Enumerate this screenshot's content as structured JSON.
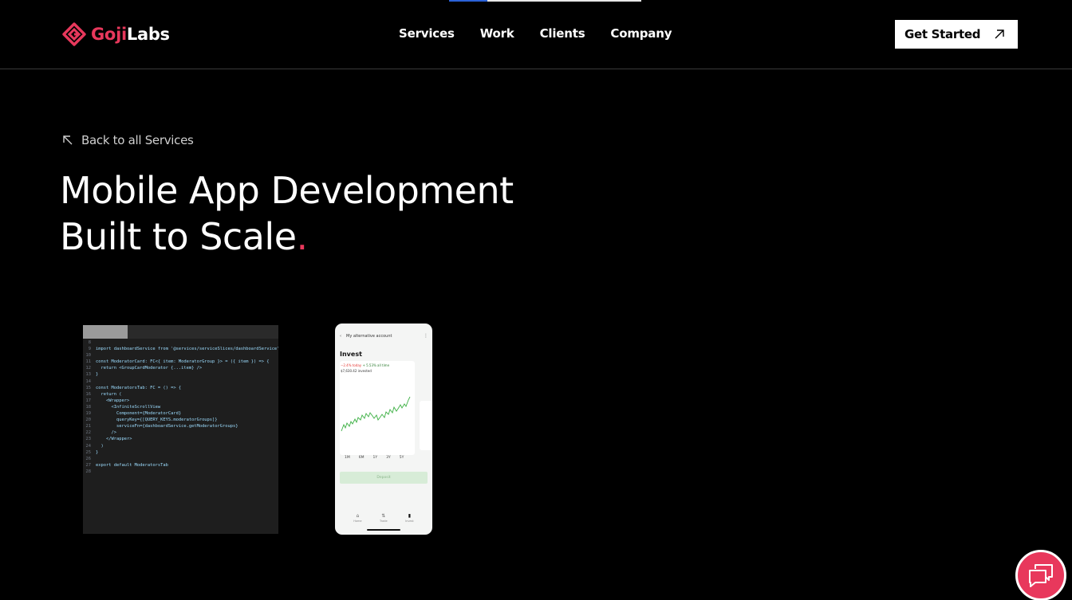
{
  "brand": {
    "name_part1": "Goji",
    "name_part2": "Labs",
    "accent_color": "#e8385c",
    "logo_icon": "diamond-logo-icon"
  },
  "nav": {
    "items": [
      {
        "label": "Services"
      },
      {
        "label": "Work"
      },
      {
        "label": "Clients"
      },
      {
        "label": "Company"
      }
    ],
    "cta_label": "Get Started",
    "cta_icon": "arrow-up-right-icon"
  },
  "hero": {
    "back_label": "Back to all Services",
    "back_icon": "arrow-up-left-icon",
    "title_line1": "Mobile App Development",
    "title_line2": "Built to Scale",
    "title_dot": "."
  },
  "code_preview": {
    "lines": [
      {
        "n": "8",
        "t": ""
      },
      {
        "n": "9",
        "t": "import dashboardService from '@services/serviceSlices/dashboardService'"
      },
      {
        "n": "10",
        "t": ""
      },
      {
        "n": "11",
        "t": "const ModeratorCard: FC<{ item: ModeratorGroup }> = ({ item }) => {"
      },
      {
        "n": "12",
        "t": "  return <GroupCardModerator {...item} />"
      },
      {
        "n": "13",
        "t": "}"
      },
      {
        "n": "14",
        "t": ""
      },
      {
        "n": "15",
        "t": "const ModeratorsTab: FC = () => {"
      },
      {
        "n": "16",
        "t": "  return ("
      },
      {
        "n": "17",
        "t": "    <Wrapper>"
      },
      {
        "n": "18",
        "t": "      <InfiniteScrollView"
      },
      {
        "n": "19",
        "t": "        Component={ModeratorCard}"
      },
      {
        "n": "20",
        "t": "        queryKey={[QUERY_KEYS.moderatorGroups]}"
      },
      {
        "n": "21",
        "t": "        serviceFn={dashboardService.getModeratorGroups}"
      },
      {
        "n": "22",
        "t": "      />"
      },
      {
        "n": "23",
        "t": "    </Wrapper>"
      },
      {
        "n": "24",
        "t": "  )"
      },
      {
        "n": "25",
        "t": "}"
      },
      {
        "n": "26",
        "t": ""
      },
      {
        "n": "27",
        "t": "export default ModeratorsTab"
      },
      {
        "n": "28",
        "t": ""
      }
    ]
  },
  "phone_preview": {
    "back_glyph": "‹",
    "account": "My alternative account",
    "menu_glyph": "⋮",
    "title": "Invest",
    "stat_today": "−2.4% today",
    "stat_all": "+ 5.53% all time",
    "stat_sub": "$7,630.42 invested",
    "periods": [
      "1M",
      "6M",
      "1Y",
      "3Y",
      "5Y"
    ],
    "button": "Deposit",
    "tabs": [
      {
        "icon": "⌂",
        "label": "Home"
      },
      {
        "icon": "⇅",
        "label": "Trade"
      },
      {
        "icon": "▮",
        "label": "Invest"
      }
    ]
  },
  "chat": {
    "icon": "chat-bubbles-icon"
  }
}
